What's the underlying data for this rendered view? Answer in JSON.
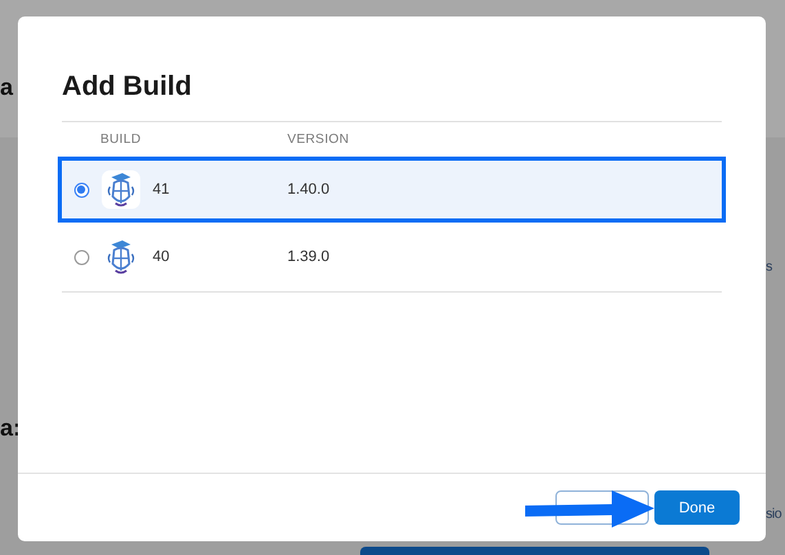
{
  "background": {
    "left_fragments": [
      "a",
      "a:"
    ],
    "right_fragments": [
      "s",
      "sio"
    ]
  },
  "dialog": {
    "title": "Add Build",
    "columns": [
      "BUILD",
      "VERSION"
    ],
    "rows": [
      {
        "build": "41",
        "version": "1.40.0",
        "selected": true
      },
      {
        "build": "40",
        "version": "1.39.0",
        "selected": false
      }
    ],
    "buttons": [
      {
        "kind": "blank"
      },
      {
        "kind": "primary",
        "label": "Done"
      }
    ]
  }
}
